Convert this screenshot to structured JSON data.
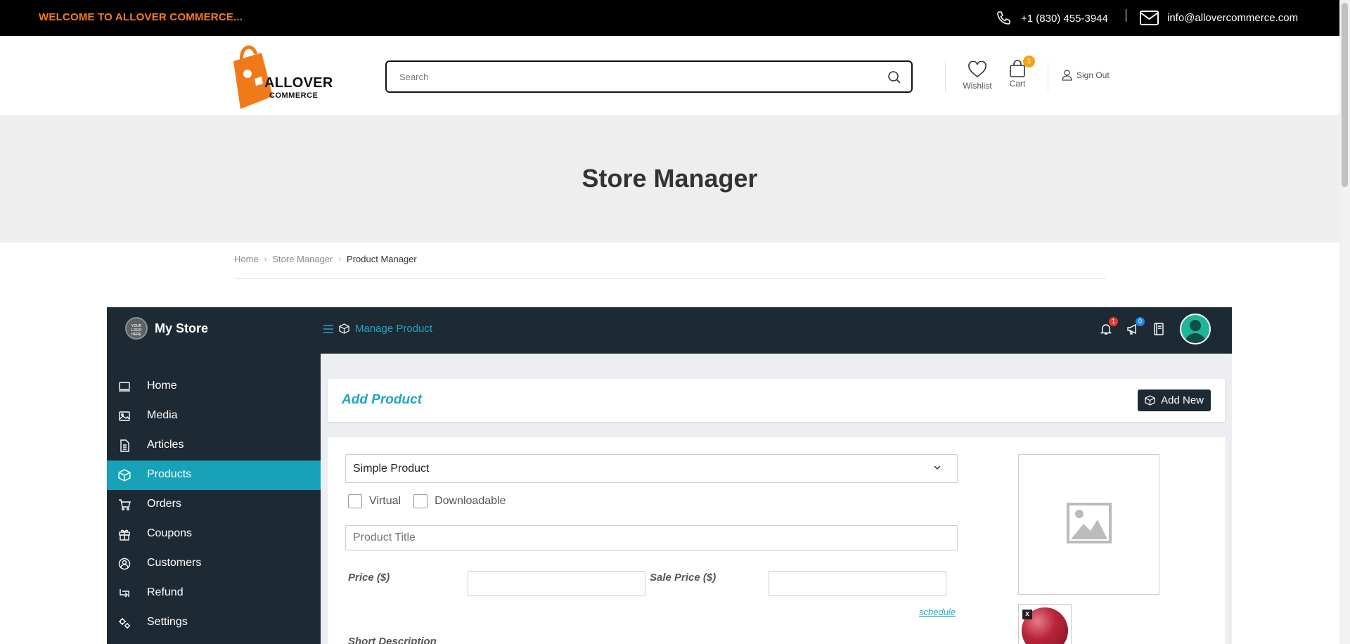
{
  "topbar": {
    "welcome": "WELCOME TO ALLOVER COMMERCE...",
    "phone": "+1 (830) 455-3944",
    "email": "info@allovercommerce.com"
  },
  "header": {
    "logo_line1": "ALLOVER",
    "logo_line2": "COMMERCE",
    "search_placeholder": "Search",
    "wishlist_label": "Wishlist",
    "cart_label": "Cart",
    "cart_count": "1",
    "signout_label": "Sign Out"
  },
  "hero": {
    "title": "Store Manager"
  },
  "breadcrumb": {
    "items": [
      "Home",
      "Store Manager",
      "Product Manager"
    ]
  },
  "store": {
    "name": "My Store",
    "logo_text": "YOUR LOGO HERE",
    "manage_label": "Manage Product",
    "notification_count": "1",
    "announcement_count": "0"
  },
  "sidebar": {
    "items": [
      {
        "label": "Home",
        "icon": "monitor-icon"
      },
      {
        "label": "Media",
        "icon": "image-icon"
      },
      {
        "label": "Articles",
        "icon": "document-icon"
      },
      {
        "label": "Products",
        "icon": "cube-icon",
        "active": true
      },
      {
        "label": "Orders",
        "icon": "cart-icon"
      },
      {
        "label": "Coupons",
        "icon": "gift-icon"
      },
      {
        "label": "Customers",
        "icon": "user-circle-icon"
      },
      {
        "label": "Refund",
        "icon": "retweet-icon"
      },
      {
        "label": "Settings",
        "icon": "gears-icon"
      }
    ]
  },
  "main": {
    "panel_title": "Add Product",
    "add_new_label": "Add New",
    "product_type": "Simple Product",
    "virtual_label": "Virtual",
    "downloadable_label": "Downloadable",
    "title_placeholder": "Product Title",
    "price_label": "Price ($)",
    "sale_price_label": "Sale Price ($)",
    "schedule_label": "schedule",
    "short_description_label": "Short Description",
    "thumb_remove": "x"
  },
  "colors": {
    "accent": "#17a2b8",
    "link": "#20a5c2",
    "dark": "#1e2a33",
    "orange": "#f47b20"
  }
}
